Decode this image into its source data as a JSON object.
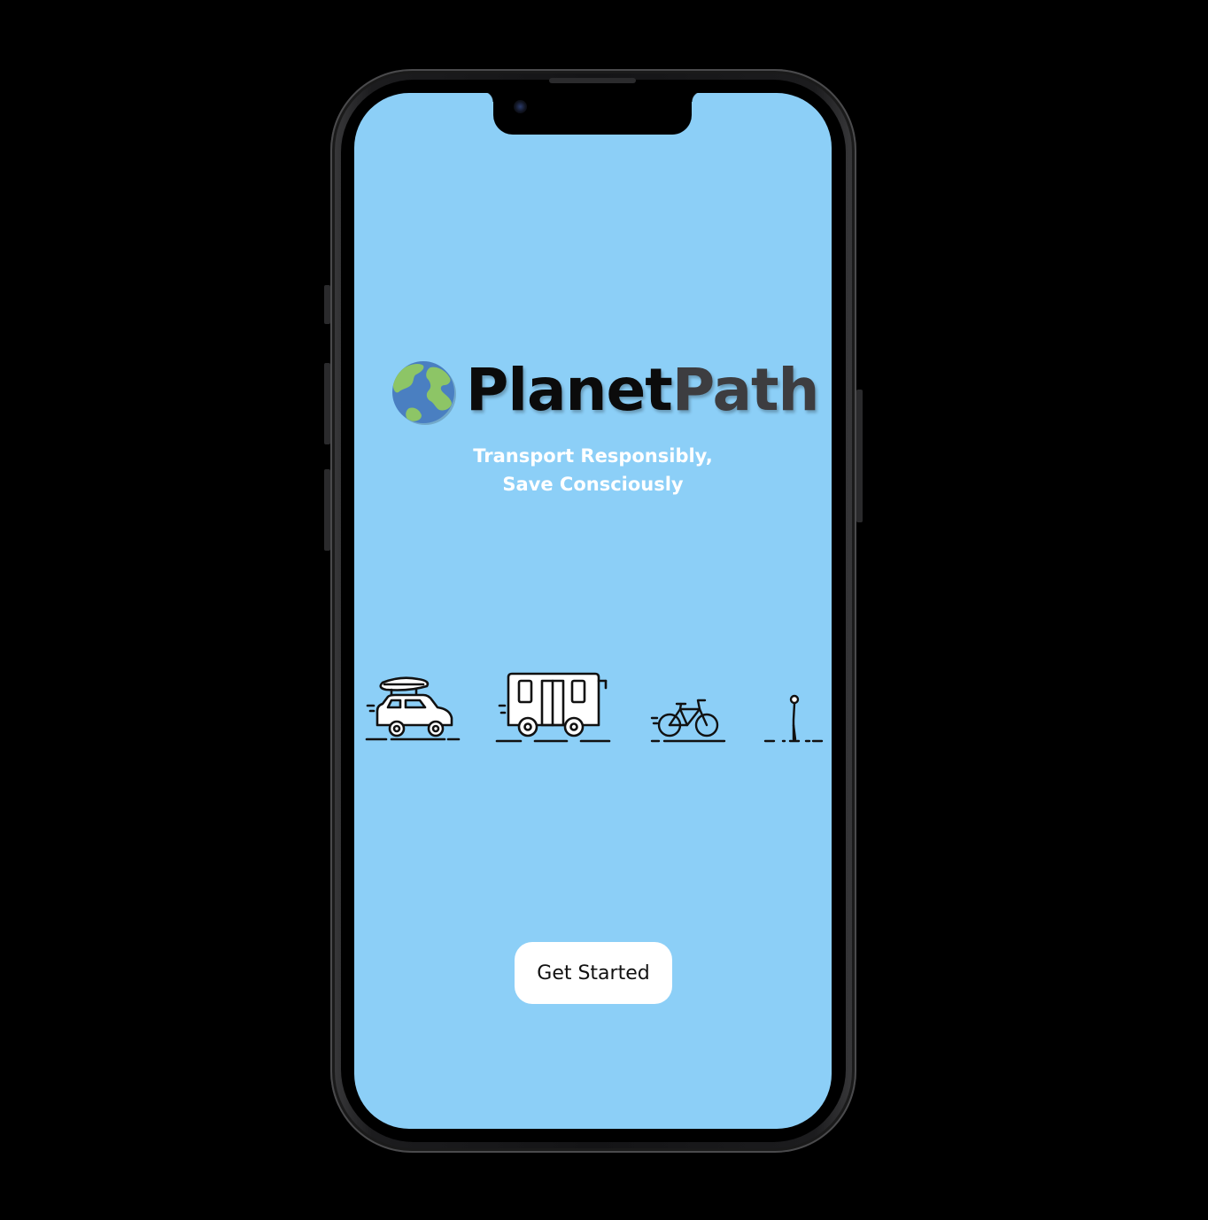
{
  "app": {
    "brand_part1": "Planet",
    "brand_part2": "Path",
    "tagline_line1": "Transport Responsibly,",
    "tagline_line2": "Save Consciously"
  },
  "icons": [
    "globe-logo-icon",
    "car-icon",
    "bus-icon",
    "bicycle-icon",
    "walking-person-icon"
  ],
  "actions": {
    "get_started_label": "Get Started"
  },
  "colors": {
    "screen_background": "#8ccff7",
    "brand_dark": "#0b0b0b",
    "brand_gray": "#3d3d40",
    "tagline": "#ffffff",
    "button_background": "#ffffff",
    "globe_ocean": "#4a7fc1",
    "globe_land": "#8dc566"
  }
}
